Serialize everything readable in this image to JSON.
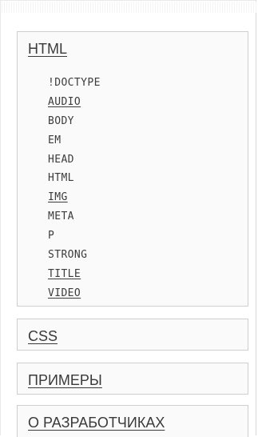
{
  "sections": {
    "html": {
      "title": "HTML",
      "items": [
        {
          "label": "!DOCTYPE",
          "link": false
        },
        {
          "label": "AUDIO",
          "link": true
        },
        {
          "label": "BODY",
          "link": false
        },
        {
          "label": "EM",
          "link": false
        },
        {
          "label": "HEAD",
          "link": false
        },
        {
          "label": "HTML",
          "link": false
        },
        {
          "label": "IMG",
          "link": true
        },
        {
          "label": "META",
          "link": false
        },
        {
          "label": "P",
          "link": false
        },
        {
          "label": "STRONG",
          "link": false
        },
        {
          "label": "TITLE",
          "link": true
        },
        {
          "label": "VIDEO",
          "link": true
        }
      ]
    },
    "css": {
      "title": "CSS"
    },
    "examples": {
      "title": "ПРИМЕРЫ"
    },
    "developers": {
      "title": "О РАЗРАБОТЧИКАХ"
    }
  }
}
